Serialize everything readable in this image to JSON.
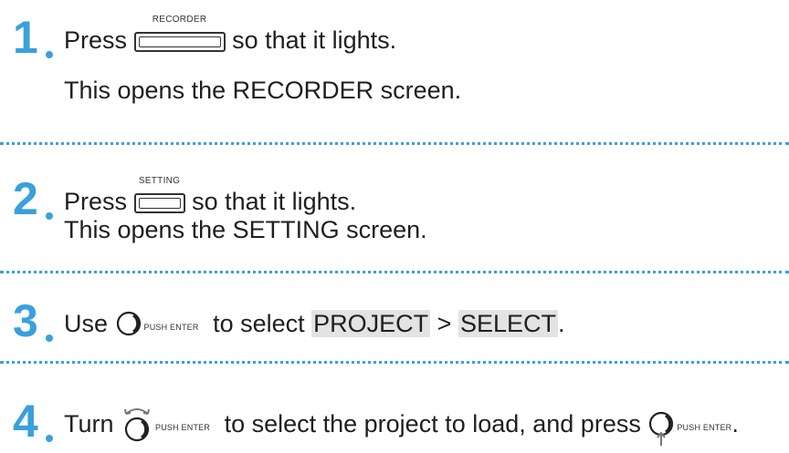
{
  "steps": [
    {
      "number": "1",
      "before": "Press",
      "button_caption": "RECORDER",
      "after": "so that it lights.",
      "sub": "This opens the RECORDER screen."
    },
    {
      "number": "2",
      "before": "Press",
      "button_caption": "SETTING",
      "after": "so that it lights.",
      "sub": "This opens the SETTING screen."
    },
    {
      "number": "3",
      "before": "Use",
      "knob_label": "PUSH ENTER",
      "middle": "to select",
      "menu_item_1": "PROJECT",
      "separator": ">",
      "menu_item_2": "SELECT",
      "end": "."
    },
    {
      "number": "4",
      "before": "Turn",
      "knob_label": "PUSH ENTER",
      "middle": "to select the project to load, and press",
      "knob_label_2": "PUSH ENTER",
      "end": "."
    }
  ],
  "colors": {
    "accent": "#3aa0dc",
    "highlight": "#e3e3e3",
    "text": "#1f1f1f"
  },
  "icons": [
    "recorder-button-icon",
    "setting-button-icon",
    "push-enter-dial-icon",
    "turn-dial-icon",
    "press-dial-icon"
  ]
}
